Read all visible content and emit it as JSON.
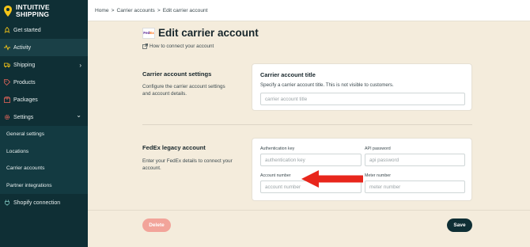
{
  "brand": {
    "name_line1": "INTUITIVE",
    "name_line2": "SHIPPING"
  },
  "sidebar": {
    "items": [
      {
        "label": "Get started",
        "icon": "rocket-icon"
      },
      {
        "label": "Activity",
        "icon": "pulse-icon",
        "active": true
      },
      {
        "label": "Shipping",
        "icon": "truck-icon",
        "chevron": "›"
      },
      {
        "label": "Products",
        "icon": "tag-icon"
      },
      {
        "label": "Packages",
        "icon": "box-icon"
      },
      {
        "label": "Settings",
        "icon": "gear-icon",
        "chevron": "⌄"
      },
      {
        "label": "Shopify connection",
        "icon": "plug-icon"
      }
    ],
    "settings_sub": [
      "General settings",
      "Locations",
      "Carrier accounts",
      "Partner integrations"
    ]
  },
  "breadcrumb": {
    "home": "Home",
    "sep": ">",
    "carrier_accounts": "Carrier accounts",
    "current": "Edit carrier account"
  },
  "page": {
    "logo_fe": "Fed",
    "logo_ex": "Ex",
    "title": "Edit carrier account",
    "help_link": "How to connect your account"
  },
  "settings_section": {
    "title": "Carrier account settings",
    "description": "Configure the carrier account settings and account details.",
    "card_title": "Carrier account title",
    "card_sub": "Specify a carrier account title. This is not visible to customers.",
    "title_placeholder": "carrier account title",
    "title_value": ""
  },
  "fedex_section": {
    "title": "FedEx legacy account",
    "description": "Enter your FedEx details to connect your account.",
    "fields": {
      "auth_key": {
        "label": "Authentication key",
        "placeholder": "authentication key",
        "value": ""
      },
      "api_password": {
        "label": "API password",
        "placeholder": "api password",
        "value": ""
      },
      "account_number": {
        "label": "Account number",
        "placeholder": "account number",
        "value": ""
      },
      "meter_number": {
        "label": "Meter number",
        "placeholder": "meter number",
        "value": ""
      }
    }
  },
  "actions": {
    "delete_label": "Delete",
    "save_label": "Save"
  },
  "colors": {
    "sidebar_bg": "#0f2f35",
    "page_bg": "#f4ecdc",
    "delete_bg": "#f2a49a",
    "save_bg": "#0f2f35",
    "arrow_red": "#e8261c"
  }
}
